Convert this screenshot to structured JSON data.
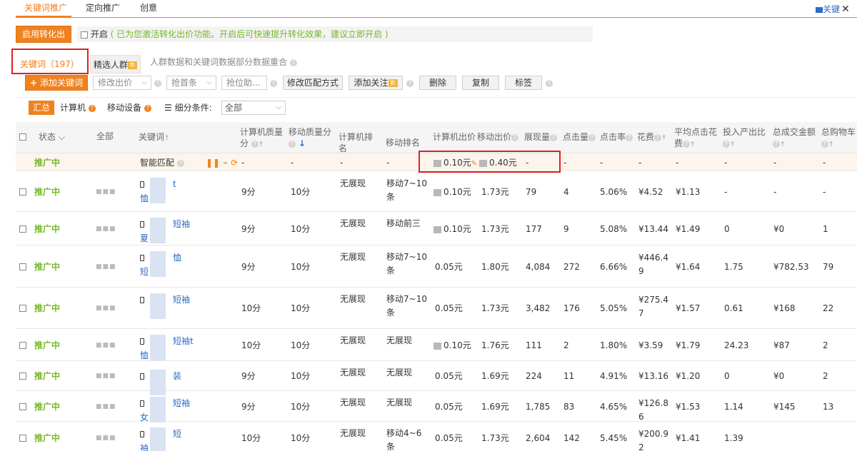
{
  "top_tabs": [
    "关键词推广",
    "定向推广",
    "创意"
  ],
  "top_right": {
    "label": "关键"
  },
  "conversion": {
    "button": "启用转化出",
    "toggle_label": "开启",
    "hint": "( 已为您激活转化出价功能。开启后可快速提升转化效果，建议立即开启 )"
  },
  "sub_tabs": {
    "keywords": "关键词（197）",
    "crowd": "精选人群",
    "notice": "人群数据和关键词数据部分数据重合"
  },
  "toolbar": {
    "add": "添加关键词",
    "modify_bid": "修改出价",
    "first_bar": "抢首条",
    "grab": "抢位助...",
    "match": "修改匹配方式",
    "follow": "添加关注",
    "delete": "删除",
    "copy": "复制",
    "tag": "标签"
  },
  "filters": {
    "summary": "汇总",
    "computer": "计算机",
    "mobile": "移动设备",
    "sub_condition": "细分条件:",
    "select_value": "全部"
  },
  "columns": {
    "status": "状态",
    "all": "全部",
    "keyword": "关键词",
    "pc_quality_1": "计算机质量",
    "pc_quality_2": "分",
    "mobile_quality": "移动质量分",
    "pc_rank_1": "计算机排",
    "pc_rank_2": "名",
    "mobile_rank": "移动排名",
    "pc_bid": "计算机出价",
    "mobile_bid": "移动出价",
    "impressions": "展现量",
    "clicks": "点击量",
    "ctr": "点击率",
    "cost": "花费",
    "avg_cpc_1": "平均点击花",
    "avg_cpc_2": "费",
    "roi": "投入产出比",
    "gmv": "总成交金额",
    "cart": "总购物车"
  },
  "smart_row": {
    "status": "推广中",
    "keyword": "智能匹配",
    "pc_quality": "-",
    "mobile_quality": "-",
    "pc_rank": "-",
    "mobile_rank": "-",
    "pc_bid": "0.10元",
    "mobile_bid": "0.40元",
    "impressions": "-",
    "clicks": "-",
    "ctr": "-",
    "cost": "-",
    "avg_cpc": "-",
    "roi": "-",
    "gmv": "-",
    "cart": "-"
  },
  "rows": [
    {
      "status": "推广中",
      "kw1": "t",
      "kw2": "恤",
      "pcq": "9分",
      "mq": "10分",
      "pcr": "无展现",
      "mr1": "移动7~10",
      "mr2": "条",
      "pcbid": "0.10元",
      "pcicon": true,
      "mbid": "1.73元",
      "imp": "79",
      "clk": "4",
      "ctr": "5.06%",
      "cost1": "¥4.52",
      "cost2": "",
      "cpc": "¥1.13",
      "roi": "-",
      "gmv": "-",
      "cart": "-"
    },
    {
      "status": "推广中",
      "kw1": "短袖",
      "kw2": "夏",
      "pcq": "9分",
      "mq": "10分",
      "pcr": "无展现",
      "mr1": "移动前三",
      "mr2": "",
      "pcbid": "0.10元",
      "pcicon": true,
      "mbid": "1.73元",
      "imp": "177",
      "clk": "9",
      "ctr": "5.08%",
      "cost1": "¥13.44",
      "cost2": "",
      "cpc": "¥1.49",
      "roi": "0",
      "gmv": "¥0",
      "cart": "1"
    },
    {
      "status": "推广中",
      "kw1": "恤",
      "kw2": "短",
      "pcq": "9分",
      "mq": "10分",
      "pcr": "无展现",
      "mr1": "移动7~10",
      "mr2": "条",
      "pcbid": "0.05元",
      "pcicon": false,
      "mbid": "1.80元",
      "imp": "4,084",
      "clk": "272",
      "ctr": "6.66%",
      "cost1": "¥446.4",
      "cost2": "9",
      "cpc": "¥1.64",
      "roi": "1.75",
      "gmv": "¥782.53",
      "cart": "79"
    },
    {
      "status": "推广中",
      "kw1": "短袖",
      "kw2": "",
      "pcq": "10分",
      "mq": "10分",
      "pcr": "无展现",
      "mr1": "移动7~10",
      "mr2": "条",
      "pcbid": "0.05元",
      "pcicon": false,
      "mbid": "1.73元",
      "imp": "3,482",
      "clk": "176",
      "ctr": "5.05%",
      "cost1": "¥275.4",
      "cost2": "7",
      "cpc": "¥1.57",
      "roi": "0.61",
      "gmv": "¥168",
      "cart": "22"
    },
    {
      "status": "推广中",
      "kw1": "短袖t",
      "kw2": "恤",
      "pcq": "10分",
      "mq": "10分",
      "pcr": "无展现",
      "mr1": "无展现",
      "mr2": "",
      "pcbid": "0.10元",
      "pcicon": true,
      "mbid": "1.76元",
      "imp": "111",
      "clk": "2",
      "ctr": "1.80%",
      "cost1": "¥3.59",
      "cost2": "",
      "cpc": "¥1.79",
      "roi": "24.23",
      "gmv": "¥87",
      "cart": "2"
    },
    {
      "status": "推广中",
      "kw1": "装",
      "kw2": "",
      "pcq": "9分",
      "mq": "10分",
      "pcr": "无展现",
      "mr1": "无展现",
      "mr2": "",
      "pcbid": "0.05元",
      "pcicon": false,
      "mbid": "1.69元",
      "imp": "224",
      "clk": "11",
      "ctr": "4.91%",
      "cost1": "¥13.16",
      "cost2": "",
      "cpc": "¥1.20",
      "roi": "0",
      "gmv": "¥0",
      "cart": "2"
    },
    {
      "status": "推广中",
      "kw1": "短袖",
      "kw2": "女",
      "pcq": "9分",
      "mq": "10分",
      "pcr": "无展现",
      "mr1": "无展现",
      "mr2": "",
      "pcbid": "0.05元",
      "pcicon": false,
      "mbid": "1.69元",
      "imp": "1,785",
      "clk": "83",
      "ctr": "4.65%",
      "cost1": "¥126.8",
      "cost2": "6",
      "cpc": "¥1.53",
      "roi": "1.14",
      "gmv": "¥145",
      "cart": "13"
    },
    {
      "status": "推广中",
      "kw1": "短",
      "kw2": "袖",
      "pcq": "10分",
      "mq": "10分",
      "pcr": "无展现",
      "mr1": "移动4~6",
      "mr2": "条",
      "pcbid": "0.05元",
      "pcicon": false,
      "mbid": "1.73元",
      "imp": "2,604",
      "clk": "142",
      "ctr": "5.45%",
      "cost1": "¥200.9",
      "cost2": "2",
      "cpc": "¥1.41",
      "roi": "1.39",
      "gmv": "",
      "cart": ""
    }
  ]
}
